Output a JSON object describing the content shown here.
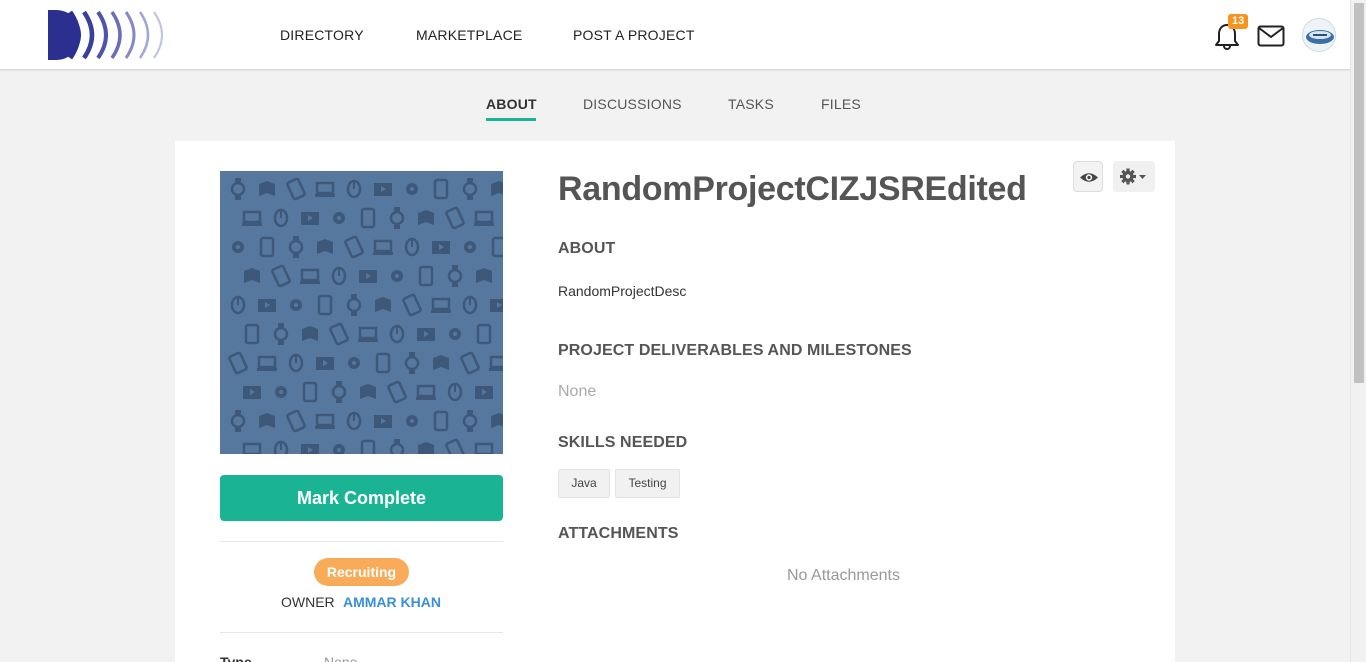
{
  "header": {
    "nav": [
      "DIRECTORY",
      "MARKETPLACE",
      "POST A PROJECT"
    ],
    "notification_count": "13"
  },
  "tabs": [
    "ABOUT",
    "DISCUSSIONS",
    "TASKS",
    "FILES"
  ],
  "project": {
    "title": "RandomProjectCIZJSREdited",
    "mark_complete_label": "Mark Complete",
    "status": "Recruiting",
    "owner_label": "OWNER",
    "owner_name": "AMMAR KHAN",
    "type_label": "Type",
    "type_value": "None"
  },
  "sections": {
    "about_heading": "ABOUT",
    "about_text": "RandomProjectDesc",
    "deliverables_heading": "PROJECT DELIVERABLES AND MILESTONES",
    "deliverables_value": "None",
    "skills_heading": "SKILLS NEEDED",
    "skills": [
      "Java",
      "Testing"
    ],
    "attachments_heading": "ATTACHMENTS",
    "attachments_empty": "No Attachments"
  },
  "colors": {
    "accent": "#1ab394",
    "status": "#f8ac59",
    "link": "#3a8fd9",
    "badge": "#f7941d",
    "image_bg": "#56789e"
  }
}
